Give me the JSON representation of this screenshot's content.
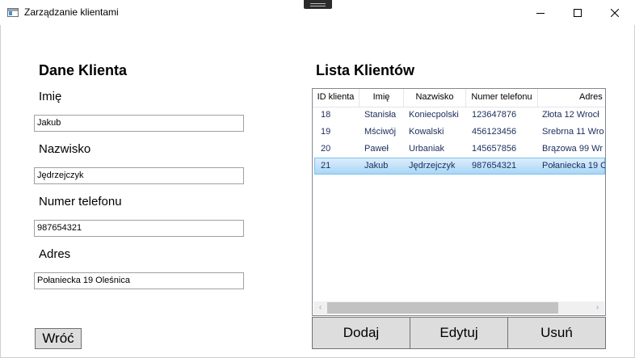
{
  "window": {
    "title": "Zarządzanie klientami"
  },
  "form": {
    "heading": "Dane Klienta",
    "fields": [
      {
        "label": "Imię",
        "value": "Jakub"
      },
      {
        "label": "Nazwisko",
        "value": "Jędrzejczyk"
      },
      {
        "label": "Numer telefonu",
        "value": "987654321"
      },
      {
        "label": "Adres",
        "value": "Połaniecka 19 Oleśnica"
      }
    ],
    "back_label": "Wróć"
  },
  "list": {
    "heading": "Lista Klientów",
    "columns": [
      "ID klienta",
      "Imię",
      "Nazwisko",
      "Numer telefonu",
      "Adres"
    ],
    "rows": [
      [
        "18",
        "Stanisła",
        "Koniecpolski",
        "123647876",
        "Złota 12 Wrocł"
      ],
      [
        "19",
        "Mściwój",
        "Kowalski",
        "456123456",
        "Srebrna 11 Wro"
      ],
      [
        "20",
        "Paweł",
        "Urbaniak",
        "145657856",
        "Brązowa 99 Wr"
      ],
      [
        "21",
        "Jakub",
        "Jędrzejczyk",
        "987654321",
        "Połaniecka 19 O"
      ]
    ],
    "selected_row": 3,
    "scroll_left": "‹",
    "scroll_right": "›"
  },
  "actions": {
    "add": "Dodaj",
    "edit": "Edytuj",
    "delete": "Usuń"
  }
}
